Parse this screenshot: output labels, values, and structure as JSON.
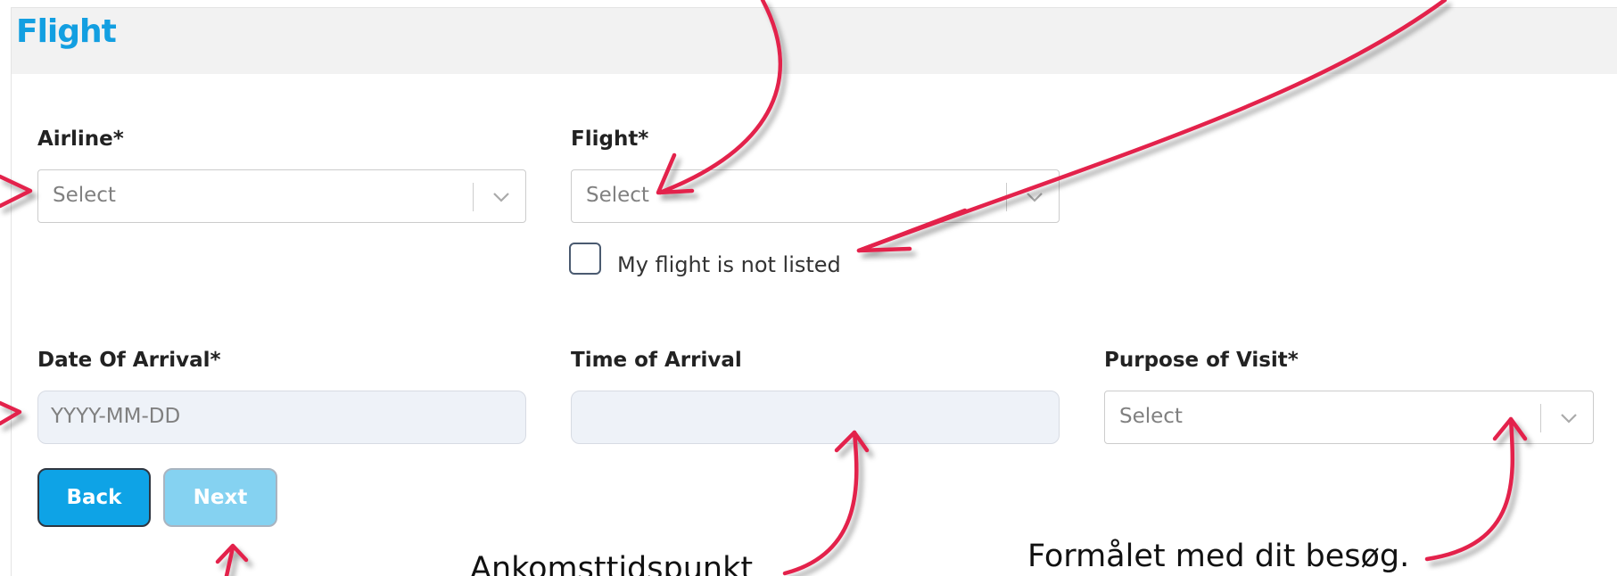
{
  "header": {
    "title": "Flight"
  },
  "fields": {
    "airline": {
      "label": "Airline*",
      "placeholder": "Select"
    },
    "flight": {
      "label": "Flight*",
      "placeholder": "Select"
    },
    "not_listed": {
      "label": "My flight is not listed",
      "checked": false
    },
    "date_of_arrival": {
      "label": "Date Of Arrival*",
      "placeholder": "YYYY-MM-DD"
    },
    "time_of_arrival": {
      "label": "Time of Arrival",
      "value": ""
    },
    "purpose_of_visit": {
      "label": "Purpose of Visit*",
      "placeholder": "Select"
    }
  },
  "buttons": {
    "back": "Back",
    "next": "Next"
  },
  "annotations": {
    "arrival_time": "Ankomsttidspunkt",
    "purpose": "Formålet med dit besøg."
  },
  "colors": {
    "title": "#139fe1",
    "primary_button": "#0ea3e6",
    "disabled_button": "#85d2f1",
    "annotation_arrow": "#e3204b"
  }
}
